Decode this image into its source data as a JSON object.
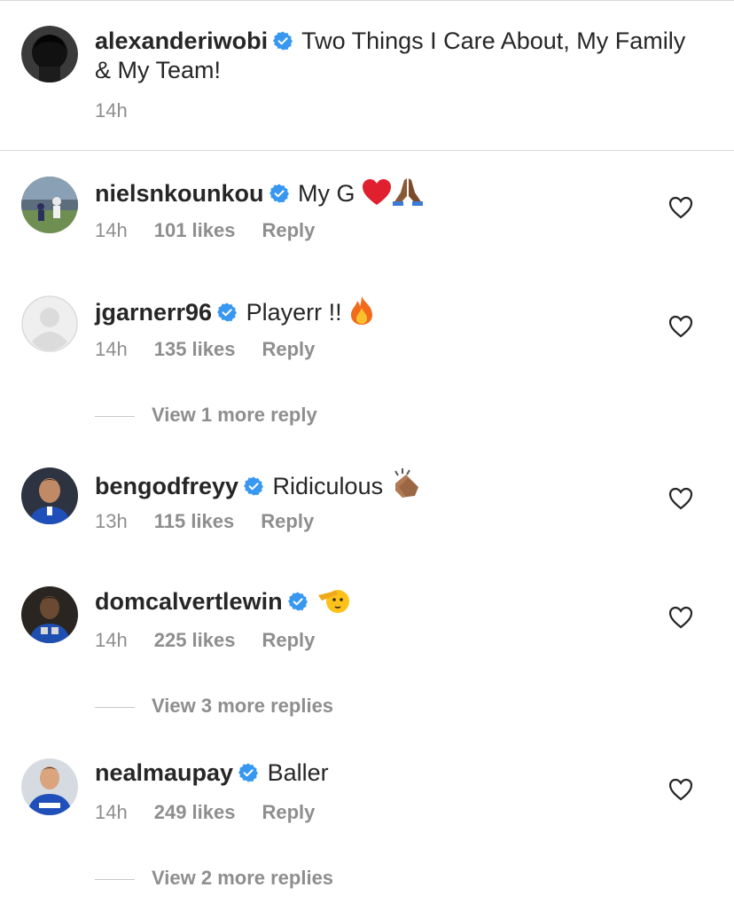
{
  "caption": {
    "username": "alexanderiwobi",
    "text": "Two Things I Care About, My Family & My Team!",
    "time": "14h",
    "avatar_icon": "avatar-dark-hair"
  },
  "comments": [
    {
      "username": "nielsnkounkou",
      "text": "My G",
      "emojis": [
        "red-heart",
        "folded-hands"
      ],
      "time": "14h",
      "likes": "101 likes",
      "reply": "Reply"
    },
    {
      "username": "jgarnerr96",
      "text": "Playerr !!",
      "emojis": [
        "fire"
      ],
      "time": "14h",
      "likes": "135 likes",
      "reply": "Reply",
      "more_replies": "View 1 more reply"
    },
    {
      "username": "bengodfreyy",
      "text": "Ridiculous",
      "emojis": [
        "clapping-hands"
      ],
      "time": "13h",
      "likes": "115 likes",
      "reply": "Reply"
    },
    {
      "username": "domcalvertlewin",
      "text": "",
      "emojis": [
        "saluting-face"
      ],
      "time": "14h",
      "likes": "225 likes",
      "reply": "Reply",
      "more_replies": "View 3 more replies"
    },
    {
      "username": "nealmaupay",
      "text": "Baller",
      "emojis": [],
      "time": "14h",
      "likes": "249 likes",
      "reply": "Reply",
      "more_replies": "View 2 more replies"
    }
  ],
  "colors": {
    "verified": "#3897f0",
    "secondary_text": "#8e8e8e",
    "primary_text": "#262626",
    "divider": "#dbdbdb"
  }
}
